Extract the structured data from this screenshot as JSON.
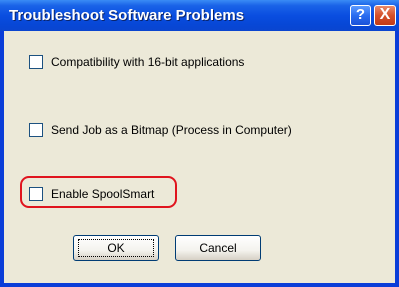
{
  "window": {
    "title": "Troubleshoot Software Problems",
    "help_button": "?",
    "close_button": "X"
  },
  "options": [
    {
      "label": "Compatibility with 16-bit applications",
      "checked": false
    },
    {
      "label": "Send Job as a Bitmap (Process in Computer)",
      "checked": false
    },
    {
      "label": "Enable SpoolSmart",
      "checked": false
    }
  ],
  "buttons": {
    "ok_label": "OK",
    "cancel_label": "Cancel"
  },
  "colors": {
    "titlebar": "#0a4ee0",
    "highlight": "#e0141e",
    "dialog_background": "#ece9d8"
  },
  "icons": {
    "help": "help-icon",
    "close": "close-icon"
  }
}
